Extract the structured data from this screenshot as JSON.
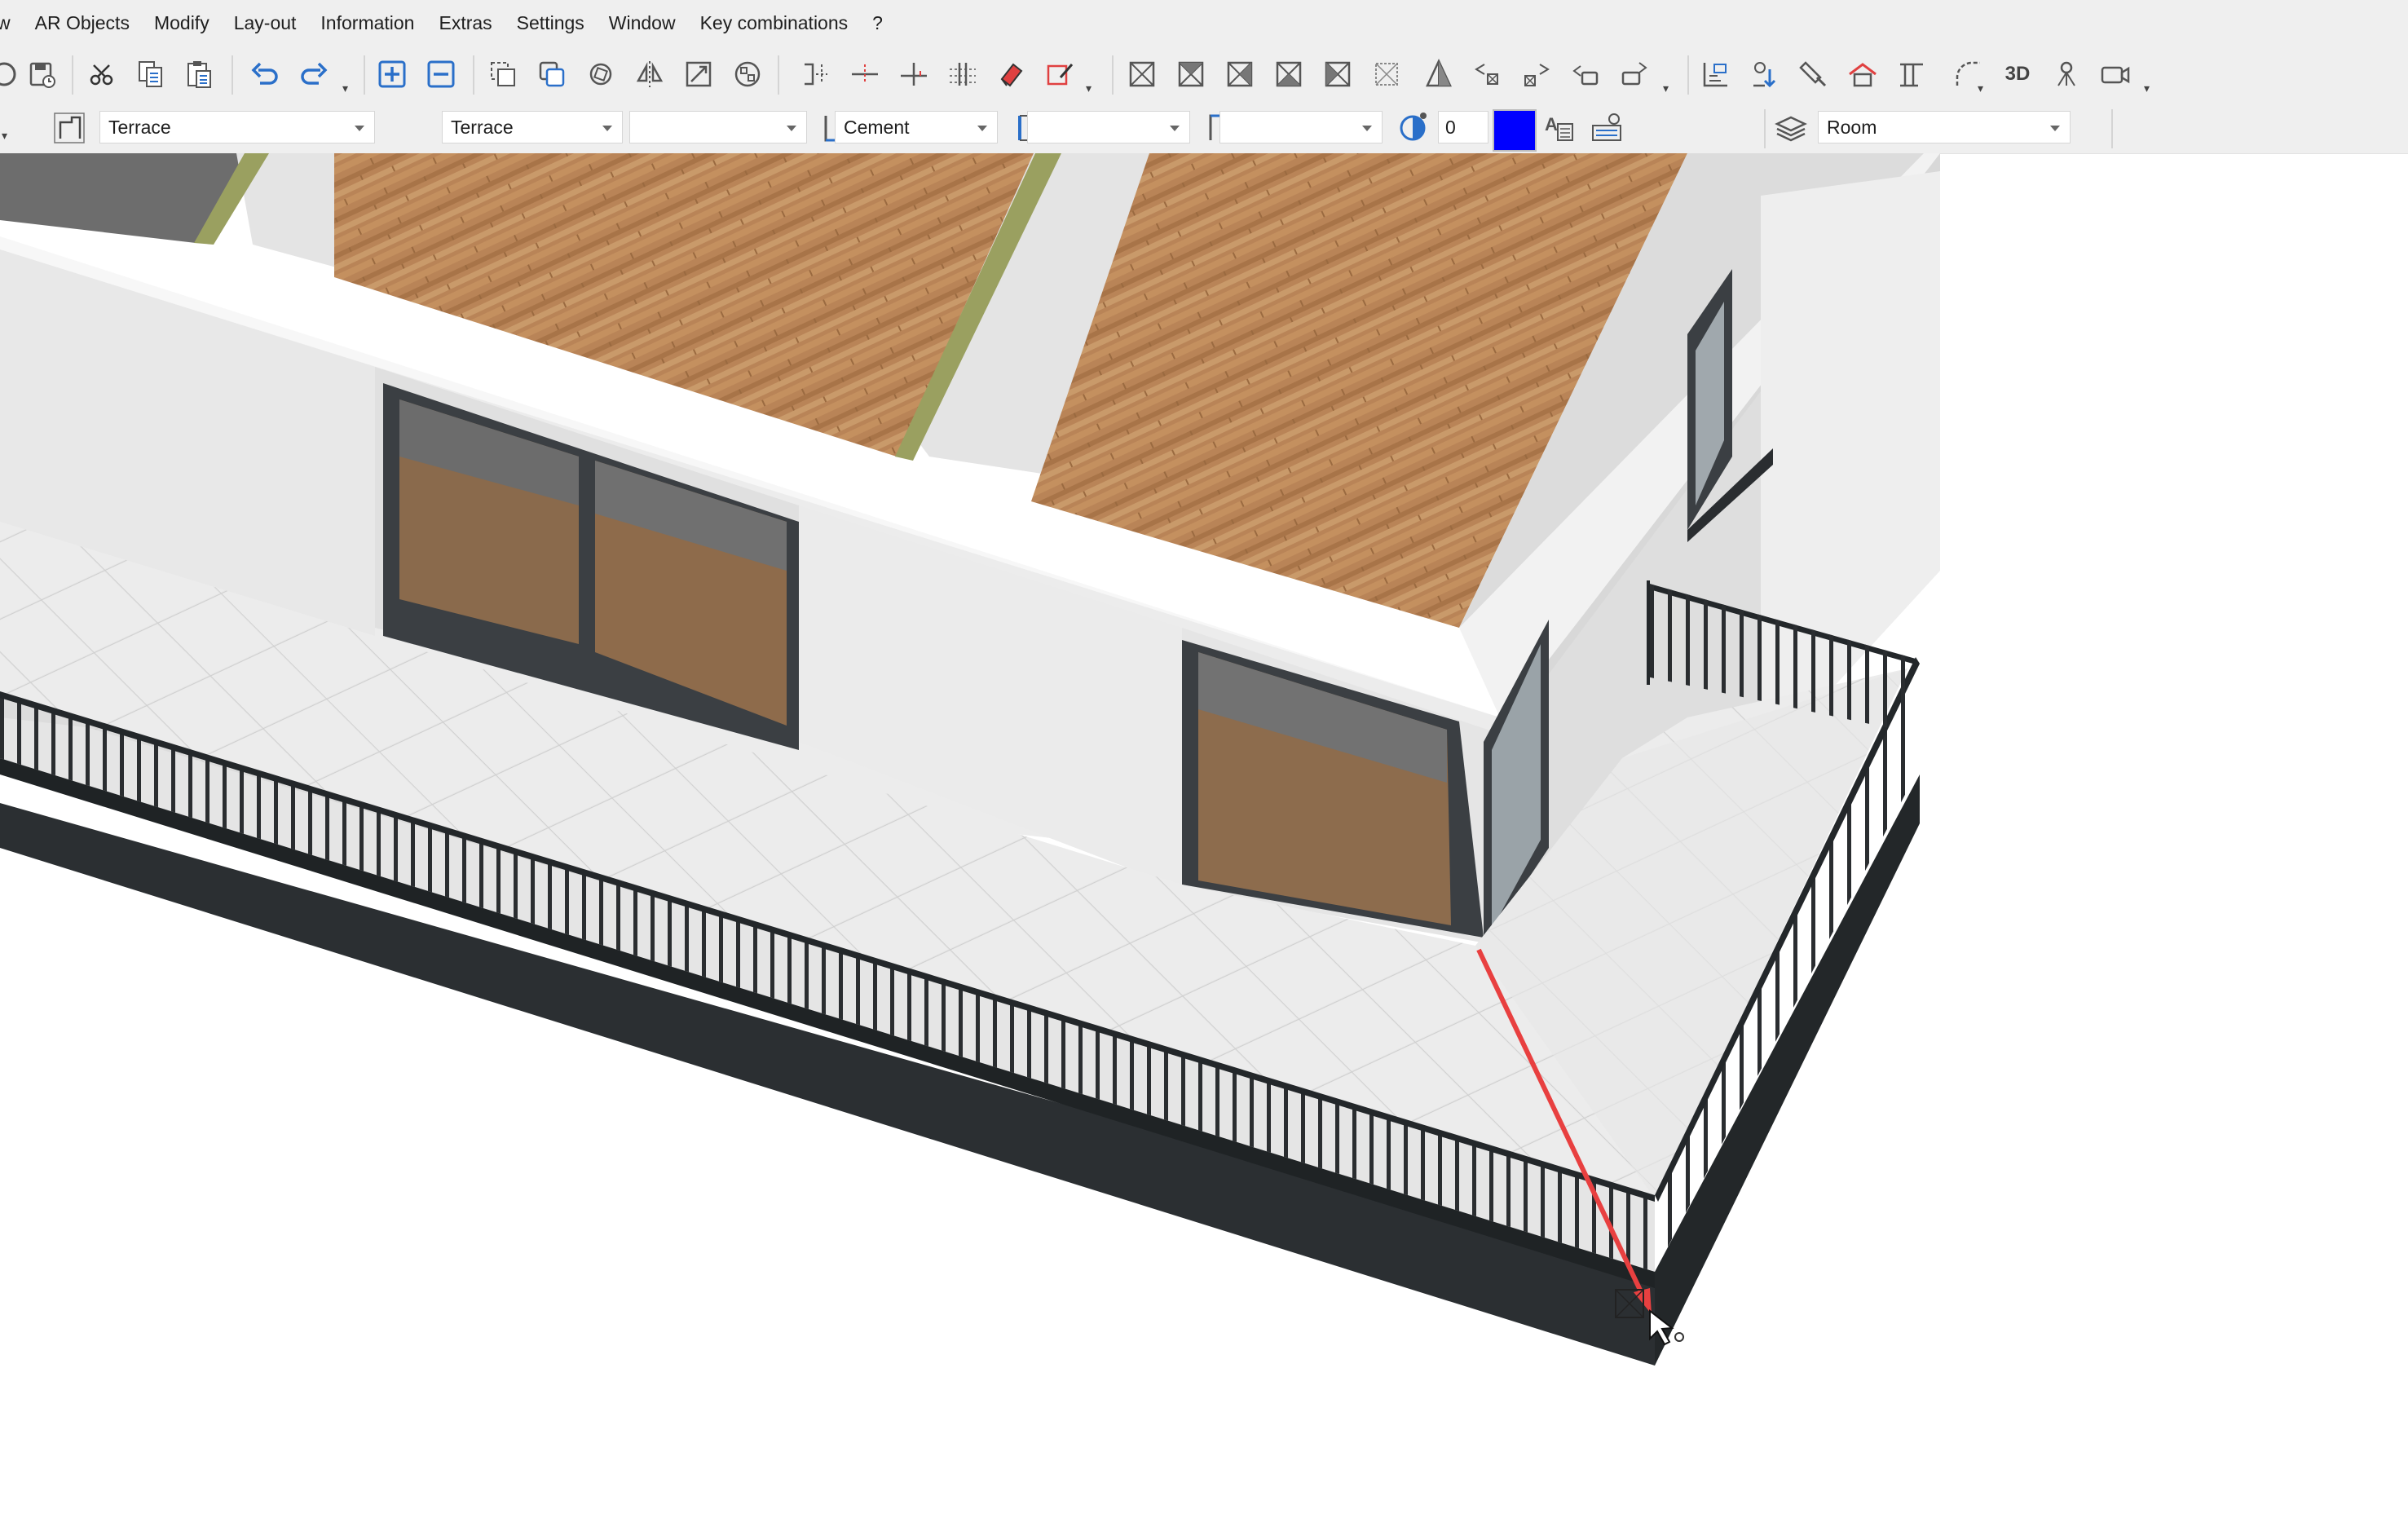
{
  "menu": [
    "w",
    "AR Objects",
    "Modify",
    "Lay-out",
    "Information",
    "Extras",
    "Settings",
    "Window",
    "Key combinations",
    "?"
  ],
  "toolbar": {
    "view3d_label": "3D"
  },
  "propbar": {
    "object_type": "Terrace",
    "object_style": "Terrace",
    "style_variant": "",
    "material": "Cement",
    "material_2": "",
    "material_3": "",
    "number_value": "0",
    "color": "#0000ff",
    "layer": "Room"
  },
  "colors": {
    "accent_blue": "#2a6fc9",
    "delete_red": "#e04040",
    "guide_line": "#e84040",
    "railing": "#262a2c",
    "wall": "#eeeeee",
    "floor_wood": "#b98457"
  }
}
